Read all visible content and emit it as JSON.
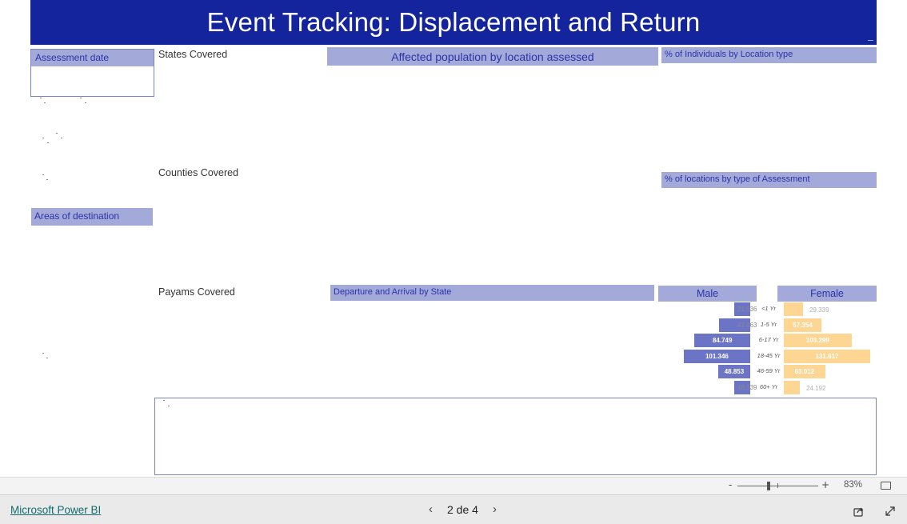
{
  "report": {
    "title": "Event Tracking: Displacement and Return",
    "colors": {
      "title_bg": "#13249c",
      "header_bg": "#a3a9d8",
      "header_text": "#2b33a8",
      "male": "#6c74c5",
      "female": "#fdd693"
    }
  },
  "slicers": {
    "assessment_date": {
      "label": "Assessment date"
    }
  },
  "labels": {
    "states_covered": "States Covered",
    "counties_covered": "Counties Covered",
    "payams_covered": "Payams Covered",
    "areas_of_destination": "Areas of destination"
  },
  "visual_headers": {
    "affected_population": "Affected population by location assessed",
    "individuals_by_location_type": "% of Individuals by Location type",
    "locations_by_assessment_type": "% of locations by type of Assessment",
    "departure_arrival": "Departure and Arrival by State"
  },
  "pyramid": {
    "male_label": "Male",
    "female_label": "Female",
    "groups": [
      {
        "age": "<1 Yr",
        "male": "21.536",
        "female": "29.339"
      },
      {
        "age": "1-5 Yr",
        "male": "47.063",
        "female": "57.354"
      },
      {
        "age": "6-17 Yr",
        "male": "84.749",
        "female": "103.299"
      },
      {
        "age": "18-45 Yr",
        "male": "101.346",
        "female": "131.617"
      },
      {
        "age": "46-59 Yr",
        "male": "48.853",
        "female": "63.012"
      },
      {
        "age": "60+ Yr",
        "male": "18.339",
        "female": "24.192"
      }
    ]
  },
  "zoom": {
    "minus": "-",
    "plus": "+",
    "level": "83%",
    "level_value": 83
  },
  "footer": {
    "brand": "Microsoft Power BI",
    "page_indicator": "2 de 4",
    "prev": "‹",
    "next": "›"
  },
  "icons": {
    "fit_page": "fit-to-page-icon",
    "share": "share-icon",
    "fullscreen": "fullscreen-icon"
  }
}
